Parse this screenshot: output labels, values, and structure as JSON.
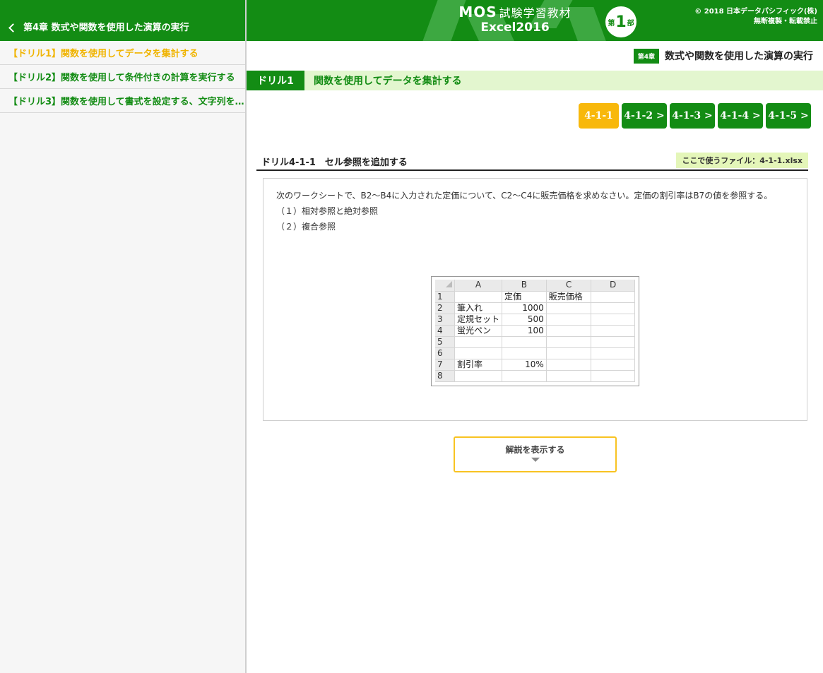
{
  "sidebar": {
    "header": "第4章 数式や関数を使用した演算の実行",
    "items": [
      {
        "label": "【ドリル1】関数を使用してデータを集計する",
        "active": true
      },
      {
        "label": "【ドリル2】関数を使用して条件付きの計算を実行する",
        "active": false
      },
      {
        "label": "【ドリル3】関数を使用して書式を設定する、文字列を…",
        "active": false
      }
    ]
  },
  "header": {
    "logo_mos": "MOS",
    "logo_sub": "試験学習教材",
    "logo_excel": "Excel2016",
    "badge_pre": "第",
    "badge_num": "1",
    "badge_post": "部",
    "copyright_line1": "© 2018 日本データパシフィック(株)",
    "copyright_line2": "無断複製・転載禁止",
    "brand_color": "#138c14"
  },
  "chapter": {
    "tag": "第4章",
    "title": "数式や関数を使用した演算の実行"
  },
  "drill": {
    "tag": "ドリル1",
    "title": "関数を使用してデータを集計する"
  },
  "steps": [
    {
      "label": "4-1-1",
      "current": true
    },
    {
      "label": "4-1-2 >",
      "current": false
    },
    {
      "label": "4-1-3 >",
      "current": false
    },
    {
      "label": "4-1-4 >",
      "current": false
    },
    {
      "label": "4-1-5 >",
      "current": false
    }
  ],
  "section": {
    "title": "ドリル4-1-1　セル参照を追加する",
    "file_label": "ここで使うファイル：4-1-1.xlsx"
  },
  "question": {
    "text": "次のワークシートで、B2～B4に入力された定価について、C2～C4に販売価格を求めなさい。定価の割引率はB7の値を参照する。",
    "option1": "（１）相対参照と絶対参照",
    "option2": "（２）複合参照"
  },
  "sheet": {
    "columns": [
      "A",
      "B",
      "C",
      "D"
    ],
    "rows": [
      {
        "n": "1",
        "a": "",
        "b": "定価",
        "c": "販売価格",
        "d": ""
      },
      {
        "n": "2",
        "a": "筆入れ",
        "b": "1000",
        "c": "",
        "d": ""
      },
      {
        "n": "3",
        "a": "定規セット",
        "b": "500",
        "c": "",
        "d": ""
      },
      {
        "n": "4",
        "a": "蛍光ペン",
        "b": "100",
        "c": "",
        "d": ""
      },
      {
        "n": "5",
        "a": "",
        "b": "",
        "c": "",
        "d": ""
      },
      {
        "n": "6",
        "a": "",
        "b": "",
        "c": "",
        "d": ""
      },
      {
        "n": "7",
        "a": "割引率",
        "b": "10%",
        "c": "",
        "d": ""
      },
      {
        "n": "8",
        "a": "",
        "b": "",
        "c": "",
        "d": ""
      }
    ]
  },
  "reveal": {
    "label": "解説を表示する"
  }
}
